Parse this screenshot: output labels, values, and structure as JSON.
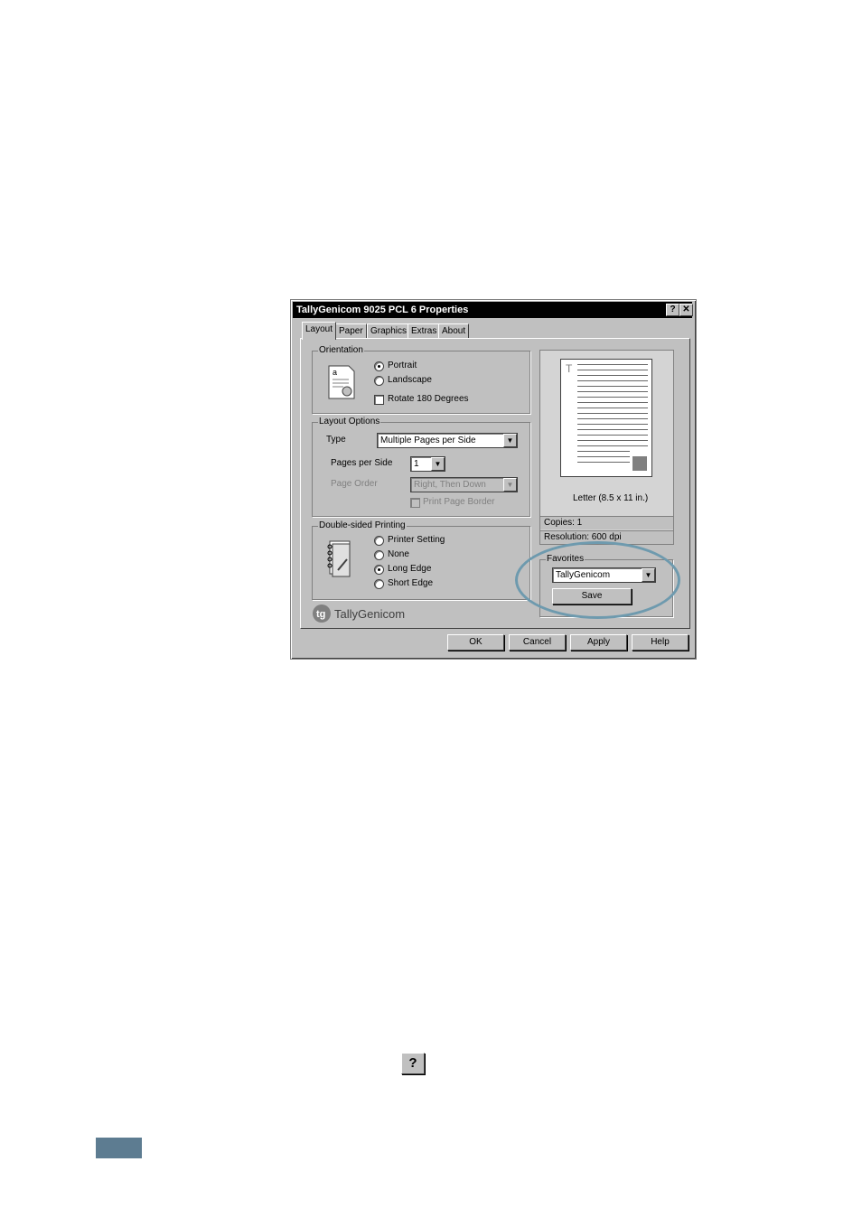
{
  "dialog": {
    "title": "TallyGenicom 9025 PCL 6 Properties",
    "title_buttons": {
      "help": "?",
      "close": "✕"
    },
    "tabs": [
      {
        "label": "Layout",
        "active": true
      },
      {
        "label": "Paper"
      },
      {
        "label": "Graphics"
      },
      {
        "label": "Extras"
      },
      {
        "label": "About"
      }
    ],
    "orientation": {
      "label": "Orientation",
      "options": [
        "Portrait",
        "Landscape"
      ],
      "selected": "Portrait",
      "rotate_label": "Rotate 180 Degrees",
      "rotate_checked": false
    },
    "layout_options": {
      "label": "Layout Options",
      "type_label": "Type",
      "type_value": "Multiple Pages per Side",
      "pages_per_side_label": "Pages per Side",
      "pages_per_side_value": "1",
      "page_order_label": "Page Order",
      "page_order_value": "Right, Then Down",
      "print_border_label": "Print Page Border"
    },
    "double_sided": {
      "label": "Double-sided Printing",
      "options": [
        "Printer Setting",
        "None",
        "Long Edge",
        "Short Edge"
      ],
      "selected": "Long Edge"
    },
    "logo_text": "TallyGenicom",
    "preview": {
      "page_size": "Letter (8.5 x 11 in.)",
      "copies": "Copies: 1",
      "resolution": "Resolution: 600 dpi"
    },
    "favorites": {
      "label": "Favorites",
      "value": "TallyGenicom",
      "save_label": "Save"
    },
    "buttons": {
      "ok": "OK",
      "cancel": "Cancel",
      "apply": "Apply",
      "help": "Help"
    }
  },
  "help_icon_glyph": "?",
  "highlight_color": "#6e9aae"
}
